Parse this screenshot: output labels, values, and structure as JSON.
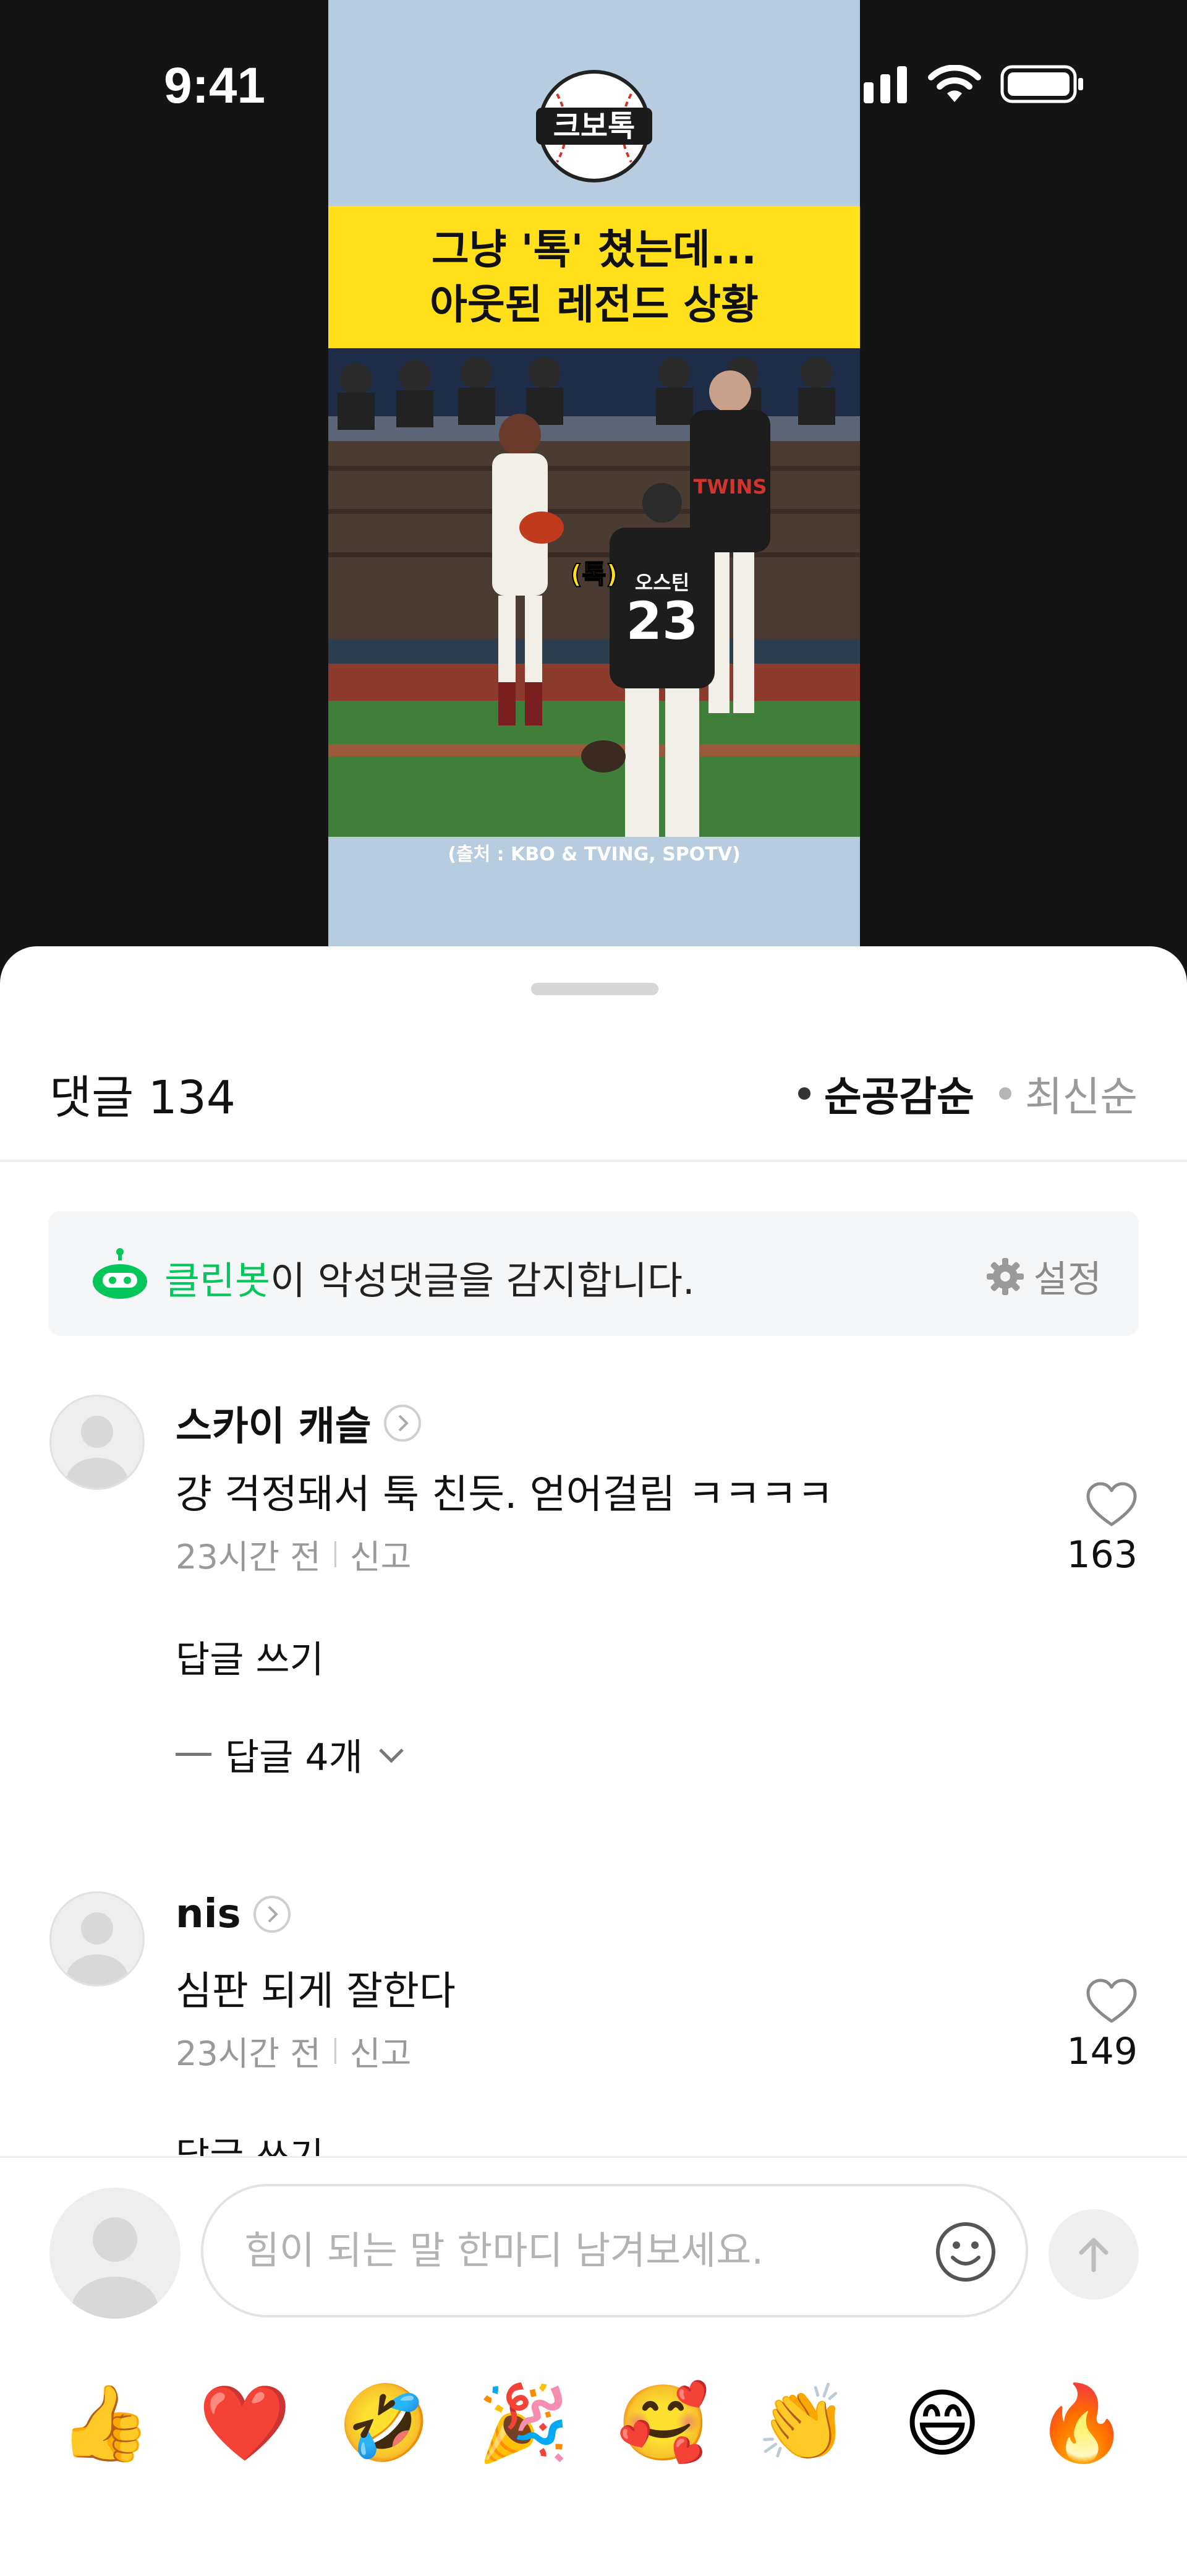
{
  "status_bar": {
    "time": "9:41"
  },
  "video": {
    "channel_logo_text": "크보톡",
    "title_line1": "그냥 '톡' 쳤는데...",
    "title_line2": "아웃된 레전드 상황",
    "caption_tok": "(톡)",
    "player_name": "오스틴",
    "player_number": "23",
    "jersey_text": "TWINS",
    "credit": "(출처 : KBO & TVING, SPOTV)"
  },
  "comments_header": {
    "label": "댓글 134",
    "sort_options": [
      "순공감순",
      "최신순"
    ],
    "active_sort": "순공감순"
  },
  "cleanbot": {
    "name": "클린봇",
    "message": "이 악성댓글을 감지합니다.",
    "settings_label": "설정"
  },
  "comments": [
    {
      "author": "스카이 캐슬",
      "text": "걍 걱정돼서 툭 친듯. 얻어걸림 ㅋㅋㅋㅋ",
      "time": "23시간 전",
      "report": "신고",
      "likes": "163",
      "reply_write": "답글 쓰기",
      "reply_count": "답글 4개"
    },
    {
      "author": "nis",
      "text": "심판 되게 잘한다",
      "time": "23시간 전",
      "report": "신고",
      "likes": "149",
      "reply_write": "답글 쓰기"
    }
  ],
  "input": {
    "placeholder": "힘이 되는 말 한마디 남겨보세요.",
    "value": ""
  },
  "emojis": [
    "👍",
    "❤️",
    "🤣",
    "🎉",
    "🥰",
    "👏",
    "😄",
    "🔥"
  ],
  "colors": {
    "accent_green": "#03c75a",
    "banner_yellow": "#ffe01a",
    "video_bg": "#b7ccdf"
  }
}
